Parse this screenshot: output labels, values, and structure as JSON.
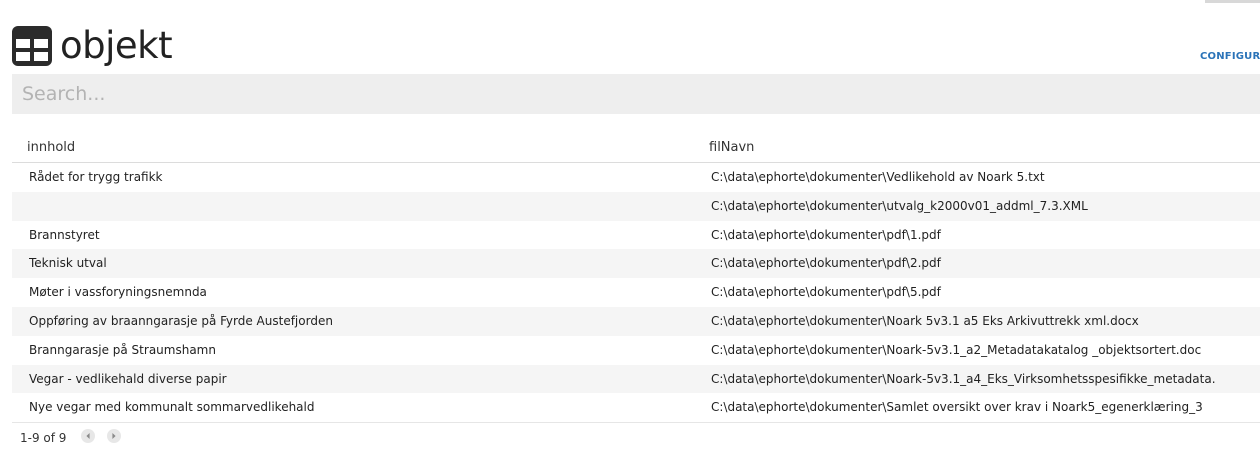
{
  "header": {
    "title": "objekt",
    "configure_label": "CONFIGURA"
  },
  "search": {
    "placeholder": "Search..."
  },
  "table": {
    "columns": [
      "innhold",
      "filNavn"
    ],
    "rows": [
      {
        "innhold": "Rådet for trygg trafikk",
        "filNavn": "C:\\data\\ephorte\\dokumenter\\Vedlikehold av Noark 5.txt"
      },
      {
        "innhold": "",
        "filNavn": "C:\\data\\ephorte\\dokumenter\\utvalg_k2000v01_addml_7.3.XML"
      },
      {
        "innhold": "Brannstyret",
        "filNavn": "C:\\data\\ephorte\\dokumenter\\pdf\\1.pdf"
      },
      {
        "innhold": "Teknisk utval",
        "filNavn": "C:\\data\\ephorte\\dokumenter\\pdf\\2.pdf"
      },
      {
        "innhold": "Møter i vassforyningsnemnda",
        "filNavn": "C:\\data\\ephorte\\dokumenter\\pdf\\5.pdf"
      },
      {
        "innhold": "Oppføring av braanngarasje på Fyrde Austefjorden",
        "filNavn": "C:\\data\\ephorte\\dokumenter\\Noark 5v3.1 a5 Eks Arkivuttrekk xml.docx"
      },
      {
        "innhold": "Branngarasje på Straumshamn",
        "filNavn": "C:\\data\\ephorte\\dokumenter\\Noark-5v3.1_a2_Metadatakatalog _objektsortert.doc"
      },
      {
        "innhold": "Vegar - vedlikehald diverse papir",
        "filNavn": "C:\\data\\ephorte\\dokumenter\\Noark-5v3.1_a4_Eks_Virksomhetsspesifikke_metadata."
      },
      {
        "innhold": "Nye vegar med kommunalt sommarvedlikehald",
        "filNavn": "C:\\data\\ephorte\\dokumenter\\Samlet oversikt over krav i Noark5_egenerklæring_3"
      }
    ]
  },
  "pagination": {
    "range_label": "1-9 of 9"
  },
  "icons": {
    "header": "table-icon",
    "prev": "chevron-left-icon",
    "next": "chevron-right-icon"
  },
  "colors": {
    "accent": "#2a73b8",
    "search_bg": "#eeeeee",
    "row_stripe": "#f5f5f5"
  }
}
